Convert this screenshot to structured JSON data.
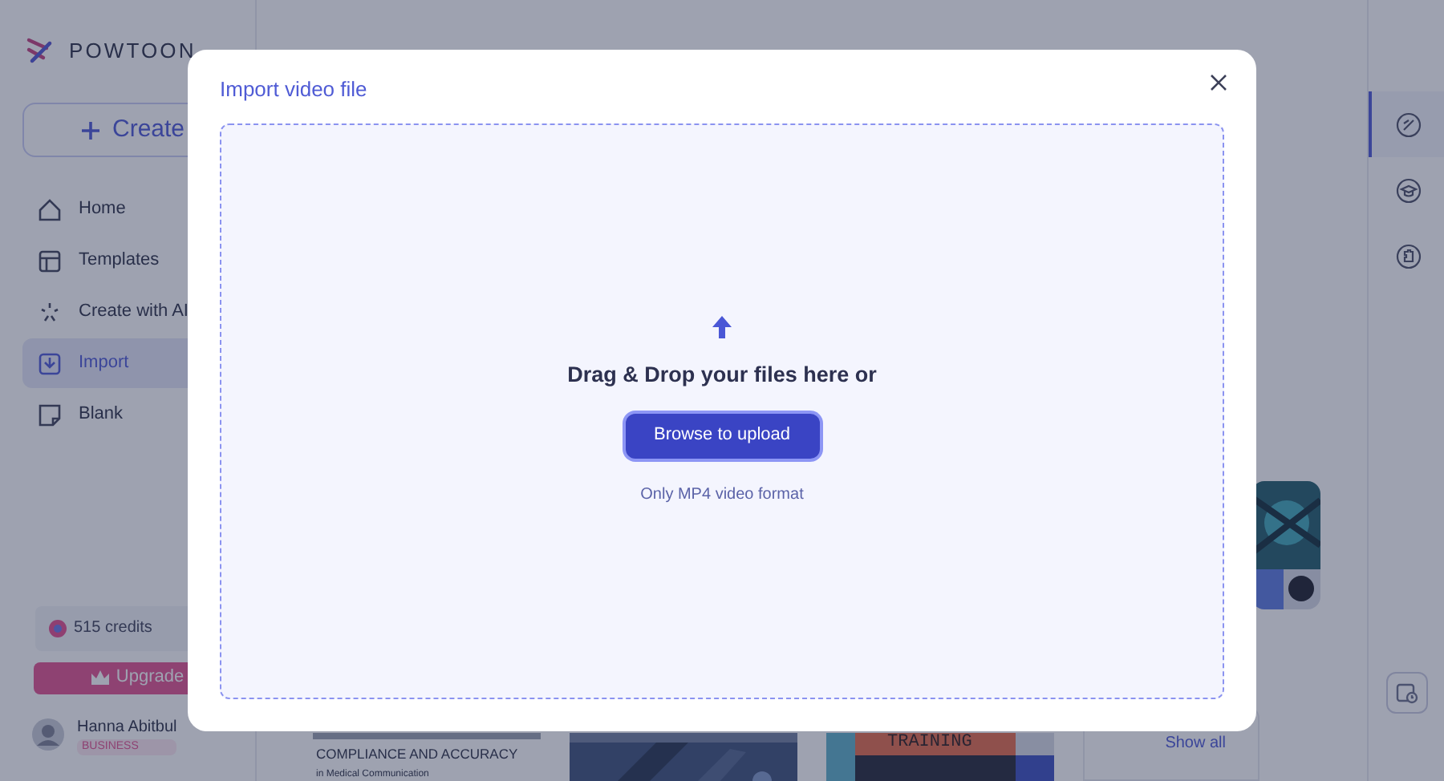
{
  "app": {
    "logo": "POWTOON",
    "create_button": "Create",
    "nav": [
      {
        "label": "Home",
        "selected": false
      },
      {
        "label": "Templates",
        "selected": false
      },
      {
        "label": "Create with AI",
        "selected": false
      },
      {
        "label": "Import",
        "selected": true
      },
      {
        "label": "Blank",
        "selected": false
      }
    ],
    "credits": "515 credits",
    "upgrade_button": "Upgrade",
    "user": {
      "name": "Hanna Abitbul",
      "plan": "BUSINESS"
    },
    "thumbnails": [
      {
        "kind": "compliance",
        "title": "COMPLIANCE AND ACCURACY",
        "subtitle": "in Medical Communication"
      },
      {
        "kind": "picture"
      },
      {
        "kind": "training",
        "title": "TRAINING"
      }
    ],
    "show_all": "Show all",
    "right_rail": [
      {
        "selected": true
      },
      {
        "selected": false
      },
      {
        "selected": false
      }
    ]
  },
  "dialog": {
    "title": "Import video file",
    "dropzone": {
      "prompt": "Drag & Drop your files here or",
      "button": "Browse to upload",
      "hint": "Only MP4 video format"
    }
  }
}
